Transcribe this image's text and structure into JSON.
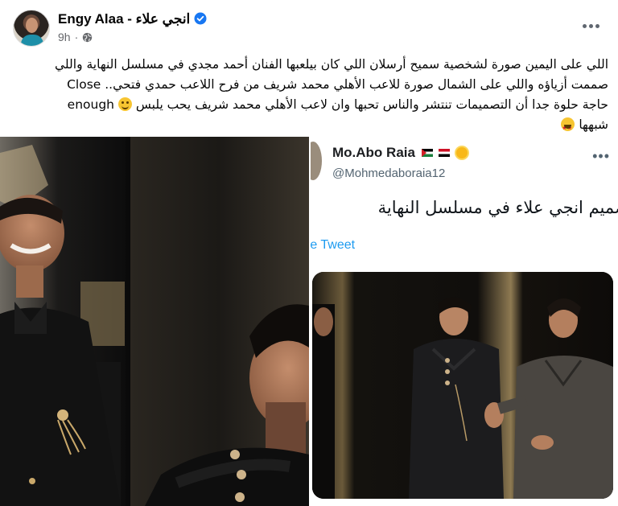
{
  "post": {
    "author_name": "Engy Alaa - انجي علاء",
    "time": "9h",
    "text_lines": [
      "اللي على اليمين صورة لشخصية سميح أرسلان اللي كان بيلعبها الفنان أحمد مجدي في مسلسل النهاية واللي",
      "صممت أزياؤه واللي على الشمال صورة للاعب الأهلي محمد شريف من فرح اللاعب حمدي فتحي.. Close",
      "enough",
      "حاجة حلوة جدا أن التصميمات تنتشر والناس تحبها وان لاعب الأهلي محمد شريف يحب يلبس",
      "شبهها"
    ]
  },
  "icons": {
    "verified": "verified-badge-icon",
    "audience": "globe-icon",
    "more": "more-options-icon"
  },
  "tweet": {
    "name": "Mo.Abo Raia",
    "handle": "@Mohmedaboraia12",
    "text": "نفس تصميم انجي علاء في مسلسل النهاية",
    "translate": "ate Tweet"
  },
  "colors": {
    "verified": "#1877f2",
    "secondary_text": "#65676b",
    "link": "#1d9bf0"
  }
}
